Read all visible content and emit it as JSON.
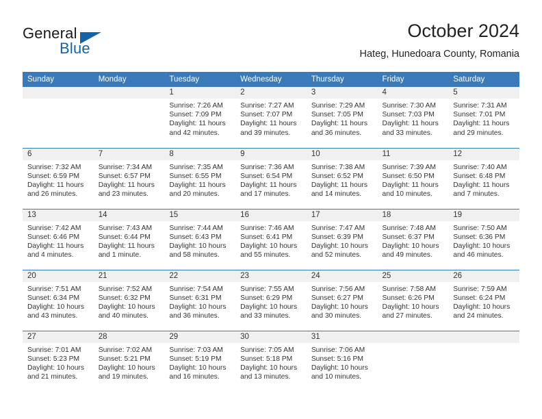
{
  "brand": {
    "name_top": "General",
    "name_bottom": "Blue",
    "color_black": "#1a1a1a",
    "color_blue": "#1464a5"
  },
  "header": {
    "title": "October 2024",
    "subtitle": "Hateg, Hunedoara County, Romania",
    "header_bg": "#3b7ab8",
    "daynum_bg": "#f0f0f0"
  },
  "weekday_headers": [
    "Sunday",
    "Monday",
    "Tuesday",
    "Wednesday",
    "Thursday",
    "Friday",
    "Saturday"
  ],
  "weeks": [
    [
      {
        "day": "",
        "sunrise": "",
        "sunset": "",
        "daylight1": "",
        "daylight2": ""
      },
      {
        "day": "",
        "sunrise": "",
        "sunset": "",
        "daylight1": "",
        "daylight2": ""
      },
      {
        "day": "1",
        "sunrise": "Sunrise: 7:26 AM",
        "sunset": "Sunset: 7:09 PM",
        "daylight1": "Daylight: 11 hours",
        "daylight2": "and 42 minutes."
      },
      {
        "day": "2",
        "sunrise": "Sunrise: 7:27 AM",
        "sunset": "Sunset: 7:07 PM",
        "daylight1": "Daylight: 11 hours",
        "daylight2": "and 39 minutes."
      },
      {
        "day": "3",
        "sunrise": "Sunrise: 7:29 AM",
        "sunset": "Sunset: 7:05 PM",
        "daylight1": "Daylight: 11 hours",
        "daylight2": "and 36 minutes."
      },
      {
        "day": "4",
        "sunrise": "Sunrise: 7:30 AM",
        "sunset": "Sunset: 7:03 PM",
        "daylight1": "Daylight: 11 hours",
        "daylight2": "and 33 minutes."
      },
      {
        "day": "5",
        "sunrise": "Sunrise: 7:31 AM",
        "sunset": "Sunset: 7:01 PM",
        "daylight1": "Daylight: 11 hours",
        "daylight2": "and 29 minutes."
      }
    ],
    [
      {
        "day": "6",
        "sunrise": "Sunrise: 7:32 AM",
        "sunset": "Sunset: 6:59 PM",
        "daylight1": "Daylight: 11 hours",
        "daylight2": "and 26 minutes."
      },
      {
        "day": "7",
        "sunrise": "Sunrise: 7:34 AM",
        "sunset": "Sunset: 6:57 PM",
        "daylight1": "Daylight: 11 hours",
        "daylight2": "and 23 minutes."
      },
      {
        "day": "8",
        "sunrise": "Sunrise: 7:35 AM",
        "sunset": "Sunset: 6:55 PM",
        "daylight1": "Daylight: 11 hours",
        "daylight2": "and 20 minutes."
      },
      {
        "day": "9",
        "sunrise": "Sunrise: 7:36 AM",
        "sunset": "Sunset: 6:54 PM",
        "daylight1": "Daylight: 11 hours",
        "daylight2": "and 17 minutes."
      },
      {
        "day": "10",
        "sunrise": "Sunrise: 7:38 AM",
        "sunset": "Sunset: 6:52 PM",
        "daylight1": "Daylight: 11 hours",
        "daylight2": "and 14 minutes."
      },
      {
        "day": "11",
        "sunrise": "Sunrise: 7:39 AM",
        "sunset": "Sunset: 6:50 PM",
        "daylight1": "Daylight: 11 hours",
        "daylight2": "and 10 minutes."
      },
      {
        "day": "12",
        "sunrise": "Sunrise: 7:40 AM",
        "sunset": "Sunset: 6:48 PM",
        "daylight1": "Daylight: 11 hours",
        "daylight2": "and 7 minutes."
      }
    ],
    [
      {
        "day": "13",
        "sunrise": "Sunrise: 7:42 AM",
        "sunset": "Sunset: 6:46 PM",
        "daylight1": "Daylight: 11 hours",
        "daylight2": "and 4 minutes."
      },
      {
        "day": "14",
        "sunrise": "Sunrise: 7:43 AM",
        "sunset": "Sunset: 6:44 PM",
        "daylight1": "Daylight: 11 hours",
        "daylight2": "and 1 minute."
      },
      {
        "day": "15",
        "sunrise": "Sunrise: 7:44 AM",
        "sunset": "Sunset: 6:43 PM",
        "daylight1": "Daylight: 10 hours",
        "daylight2": "and 58 minutes."
      },
      {
        "day": "16",
        "sunrise": "Sunrise: 7:46 AM",
        "sunset": "Sunset: 6:41 PM",
        "daylight1": "Daylight: 10 hours",
        "daylight2": "and 55 minutes."
      },
      {
        "day": "17",
        "sunrise": "Sunrise: 7:47 AM",
        "sunset": "Sunset: 6:39 PM",
        "daylight1": "Daylight: 10 hours",
        "daylight2": "and 52 minutes."
      },
      {
        "day": "18",
        "sunrise": "Sunrise: 7:48 AM",
        "sunset": "Sunset: 6:37 PM",
        "daylight1": "Daylight: 10 hours",
        "daylight2": "and 49 minutes."
      },
      {
        "day": "19",
        "sunrise": "Sunrise: 7:50 AM",
        "sunset": "Sunset: 6:36 PM",
        "daylight1": "Daylight: 10 hours",
        "daylight2": "and 46 minutes."
      }
    ],
    [
      {
        "day": "20",
        "sunrise": "Sunrise: 7:51 AM",
        "sunset": "Sunset: 6:34 PM",
        "daylight1": "Daylight: 10 hours",
        "daylight2": "and 43 minutes."
      },
      {
        "day": "21",
        "sunrise": "Sunrise: 7:52 AM",
        "sunset": "Sunset: 6:32 PM",
        "daylight1": "Daylight: 10 hours",
        "daylight2": "and 40 minutes."
      },
      {
        "day": "22",
        "sunrise": "Sunrise: 7:54 AM",
        "sunset": "Sunset: 6:31 PM",
        "daylight1": "Daylight: 10 hours",
        "daylight2": "and 36 minutes."
      },
      {
        "day": "23",
        "sunrise": "Sunrise: 7:55 AM",
        "sunset": "Sunset: 6:29 PM",
        "daylight1": "Daylight: 10 hours",
        "daylight2": "and 33 minutes."
      },
      {
        "day": "24",
        "sunrise": "Sunrise: 7:56 AM",
        "sunset": "Sunset: 6:27 PM",
        "daylight1": "Daylight: 10 hours",
        "daylight2": "and 30 minutes."
      },
      {
        "day": "25",
        "sunrise": "Sunrise: 7:58 AM",
        "sunset": "Sunset: 6:26 PM",
        "daylight1": "Daylight: 10 hours",
        "daylight2": "and 27 minutes."
      },
      {
        "day": "26",
        "sunrise": "Sunrise: 7:59 AM",
        "sunset": "Sunset: 6:24 PM",
        "daylight1": "Daylight: 10 hours",
        "daylight2": "and 24 minutes."
      }
    ],
    [
      {
        "day": "27",
        "sunrise": "Sunrise: 7:01 AM",
        "sunset": "Sunset: 5:23 PM",
        "daylight1": "Daylight: 10 hours",
        "daylight2": "and 21 minutes."
      },
      {
        "day": "28",
        "sunrise": "Sunrise: 7:02 AM",
        "sunset": "Sunset: 5:21 PM",
        "daylight1": "Daylight: 10 hours",
        "daylight2": "and 19 minutes."
      },
      {
        "day": "29",
        "sunrise": "Sunrise: 7:03 AM",
        "sunset": "Sunset: 5:19 PM",
        "daylight1": "Daylight: 10 hours",
        "daylight2": "and 16 minutes."
      },
      {
        "day": "30",
        "sunrise": "Sunrise: 7:05 AM",
        "sunset": "Sunset: 5:18 PM",
        "daylight1": "Daylight: 10 hours",
        "daylight2": "and 13 minutes."
      },
      {
        "day": "31",
        "sunrise": "Sunrise: 7:06 AM",
        "sunset": "Sunset: 5:16 PM",
        "daylight1": "Daylight: 10 hours",
        "daylight2": "and 10 minutes."
      },
      {
        "day": "",
        "sunrise": "",
        "sunset": "",
        "daylight1": "",
        "daylight2": ""
      },
      {
        "day": "",
        "sunrise": "",
        "sunset": "",
        "daylight1": "",
        "daylight2": ""
      }
    ]
  ]
}
